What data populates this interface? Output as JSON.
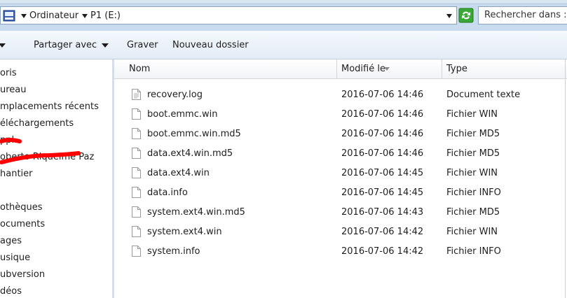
{
  "address_bar": {
    "crumbs": [
      "Ordinateur",
      "P1 (E:)"
    ],
    "search_placeholder": "Rechercher dans : P"
  },
  "toolbar": {
    "share_label": "Partager avec",
    "burn_label": "Graver",
    "new_folder_label": "Nouveau dossier"
  },
  "nav": {
    "items": [
      "oris",
      "ureau",
      "mplacements récents",
      "éléchargements",
      "ppl",
      "oberto Riquelme Paz",
      "hantier",
      "othèques",
      "ocuments",
      "ages",
      "usique",
      "ubversion",
      "déos"
    ]
  },
  "columns": {
    "name": "Nom",
    "modified": "Modifié le",
    "type": "Type"
  },
  "files": [
    {
      "name": "recovery.log",
      "date": "2016-07-06 14:46",
      "type": "Document texte"
    },
    {
      "name": "boot.emmc.win",
      "date": "2016-07-06 14:46",
      "type": "Fichier WIN"
    },
    {
      "name": "boot.emmc.win.md5",
      "date": "2016-07-06 14:46",
      "type": "Fichier MD5"
    },
    {
      "name": "data.ext4.win.md5",
      "date": "2016-07-06 14:46",
      "type": "Fichier MD5"
    },
    {
      "name": "data.ext4.win",
      "date": "2016-07-06 14:45",
      "type": "Fichier WIN"
    },
    {
      "name": "data.info",
      "date": "2016-07-06 14:45",
      "type": "Fichier INFO"
    },
    {
      "name": "system.ext4.win.md5",
      "date": "2016-07-06 14:43",
      "type": "Fichier MD5"
    },
    {
      "name": "system.ext4.win",
      "date": "2016-07-06 14:42",
      "type": "Fichier WIN"
    },
    {
      "name": "system.info",
      "date": "2016-07-06 14:42",
      "type": "Fichier INFO"
    }
  ],
  "colors": {
    "address_bg": "#c9dbee",
    "refresh_green": "#3aa835",
    "redaction_red": "#ff0000"
  }
}
